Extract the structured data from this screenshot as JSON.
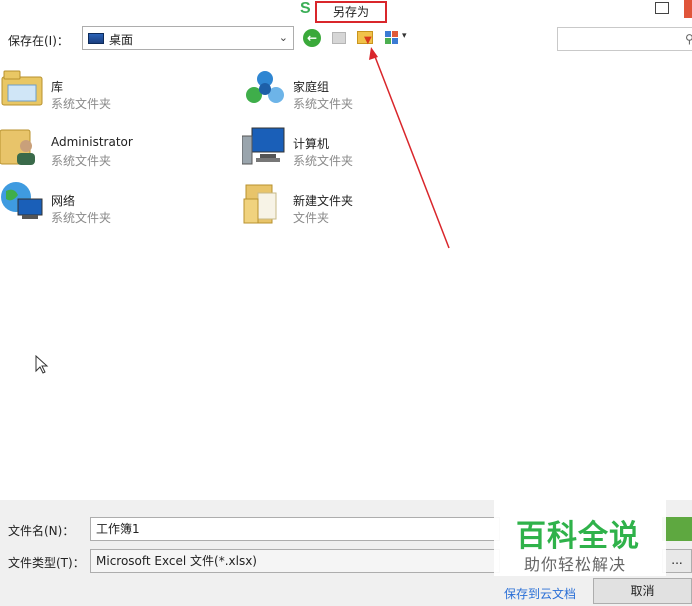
{
  "window": {
    "title": "另存为"
  },
  "toolbar": {
    "save_in_label": "保存在(I)：",
    "location": "桌面"
  },
  "files": [
    {
      "name": "库",
      "type": "系统文件夹",
      "icon": "library-icon"
    },
    {
      "name": "家庭组",
      "type": "系统文件夹",
      "icon": "homegroup-icon"
    },
    {
      "name": "Administrator",
      "type": "系统文件夹",
      "icon": "user-folder-icon"
    },
    {
      "name": "计算机",
      "type": "系统文件夹",
      "icon": "computer-icon"
    },
    {
      "name": "网络",
      "type": "系统文件夹",
      "icon": "network-icon"
    },
    {
      "name": "新建文件夹",
      "type": "文件夹",
      "icon": "folder-icon"
    }
  ],
  "bottom": {
    "filename_label": "文件名(N)：",
    "filename_value": "工作簿1",
    "filetype_label": "文件类型(T)：",
    "filetype_value": "Microsoft Excel 文件(*.xlsx)",
    "more_label": "...",
    "cloud_link": "保存到云文档",
    "cancel_label": "取消"
  },
  "watermark": {
    "title": "百科全说",
    "subtitle": "助你轻松解决"
  },
  "colors": {
    "annotation_red": "#d9262b",
    "accent_green": "#3aa93a",
    "link_blue": "#2a6fd6"
  }
}
